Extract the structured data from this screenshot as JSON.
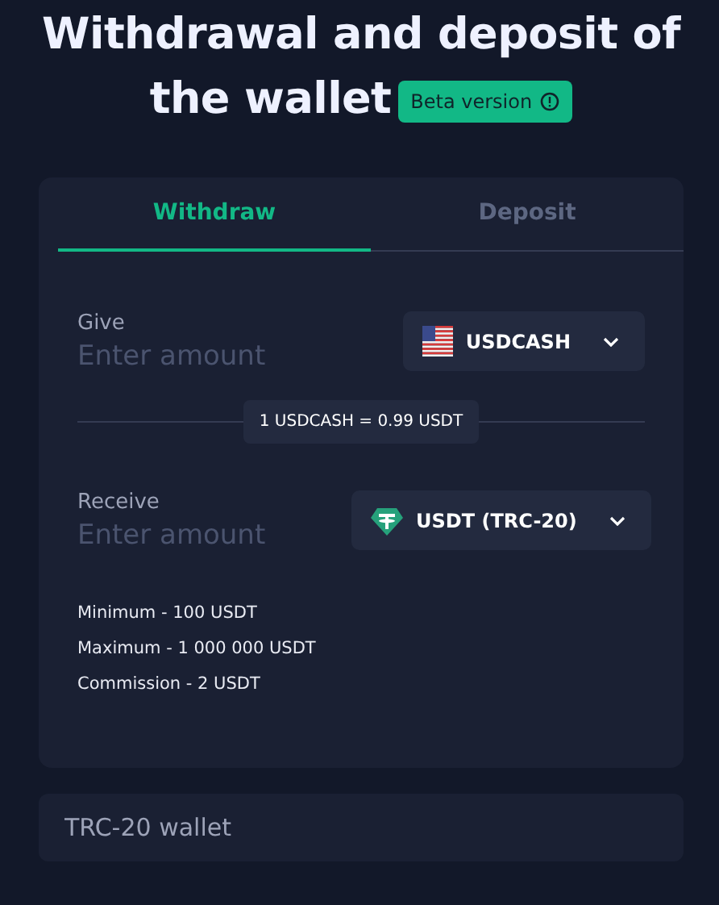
{
  "title": "Withdrawal and deposit of the wallet",
  "badge": {
    "label": "Beta version"
  },
  "tabs": [
    {
      "label": "Withdraw",
      "selected": true
    },
    {
      "label": "Deposit",
      "selected": false
    }
  ],
  "give": {
    "label": "Give",
    "placeholder": "Enter amount",
    "currency": {
      "label": "USDCASH",
      "kind": "flag"
    }
  },
  "rate": "1 USDCASH = 0.99 USDT",
  "receive": {
    "label": "Receive",
    "placeholder": "Enter amount",
    "currency": {
      "label": "USDT (TRC-20)",
      "kind": "tether"
    }
  },
  "limits": [
    "Minimum - 100 USDT",
    "Maximum - 1 000 000 USDT",
    "Commission - 2 USDT"
  ],
  "wallet": {
    "placeholder": "TRC-20 wallet"
  }
}
